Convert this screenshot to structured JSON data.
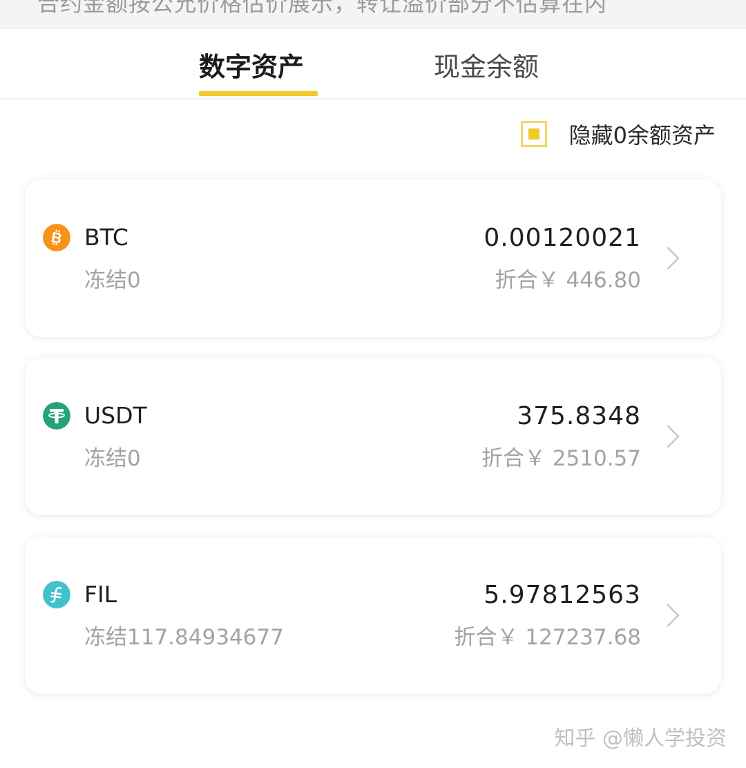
{
  "notice": {
    "text": "合约金额按公允价格估价展示，转让溢价部分不估算在内"
  },
  "tabs": [
    {
      "label": "数字资产",
      "active": true
    },
    {
      "label": "现金余额",
      "active": false
    }
  ],
  "filter": {
    "hide_zero_label": "隐藏0余额资产",
    "checked": true
  },
  "assets": [
    {
      "symbol": "BTC",
      "icon": "bitcoin-icon",
      "icon_color": "#f7931a",
      "frozen": "冻结0",
      "amount": "0.00120021",
      "value": "折合￥ 446.80"
    },
    {
      "symbol": "USDT",
      "icon": "tether-icon",
      "icon_color": "#26a17b",
      "frozen": "冻结0",
      "amount": "375.8348",
      "value": "折合￥ 2510.57"
    },
    {
      "symbol": "FIL",
      "icon": "filecoin-icon",
      "icon_color": "#42c1ca",
      "frozen": "冻结117.84934677",
      "amount": "5.97812563",
      "value": "折合￥ 127237.68"
    }
  ],
  "colors": {
    "accent": "#f0c92b"
  },
  "watermark": {
    "text": "知乎 @懒人学投资"
  }
}
